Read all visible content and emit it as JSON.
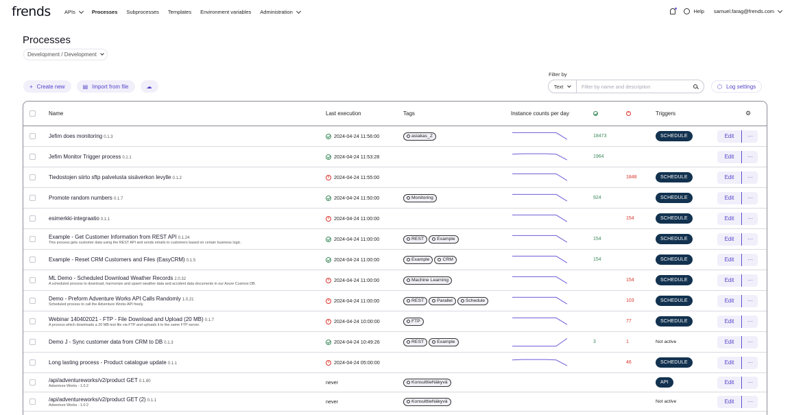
{
  "brand": {
    "logo": "frends"
  },
  "nav": {
    "items": [
      {
        "label": "APIs",
        "dropdown": true,
        "active": false
      },
      {
        "label": "Processes",
        "dropdown": false,
        "active": true
      },
      {
        "label": "Subprocesses",
        "dropdown": false,
        "active": false
      },
      {
        "label": "Templates",
        "dropdown": false,
        "active": false
      },
      {
        "label": "Environment variables",
        "dropdown": false,
        "active": false
      },
      {
        "label": "Administration",
        "dropdown": true,
        "active": false
      }
    ],
    "help": "Help",
    "user": "samuel.farag@frends.com"
  },
  "page": {
    "title": "Processes",
    "environment": "Development / Development"
  },
  "actions": {
    "create_new": "Create new",
    "import": "Import from file",
    "filter_label": "Filter by",
    "filter_type": "Text",
    "filter_placeholder": "Filter by name and description",
    "log_settings": "Log settings"
  },
  "table": {
    "headers": {
      "name": "Name",
      "last_execution": "Last execution",
      "tags": "Tags",
      "instance_counts": "Instance counts per day",
      "triggers": "Triggers"
    },
    "edit_label": "Edit",
    "more_label": "···",
    "rows": [
      {
        "name": "Jefim does monitoring",
        "version": "0.1.3",
        "desc": "",
        "status": "ok",
        "last": "2024-04-24 11:56:00",
        "tags": [
          "asiakas_Z"
        ],
        "ok": "18473",
        "err": "",
        "trigger": "SCHEDULE",
        "spark": [
          0.9,
          0.9,
          0.9,
          0.9,
          0.9,
          0.2
        ]
      },
      {
        "name": "Jefim Monitor Trigger process",
        "version": "0.1.1",
        "desc": "",
        "status": "ok",
        "last": "2024-04-24 11:53:28",
        "tags": [],
        "ok": "1964",
        "err": "",
        "trigger": "",
        "spark": [
          0.8,
          0.85,
          0.85,
          0.85,
          0.8,
          0.2
        ]
      },
      {
        "name": "Tiedostojen siirto sftp palvelusta sisäverkon levylle",
        "version": "0.1.2",
        "desc": "",
        "status": "err",
        "last": "2024-04-24 11:55:00",
        "tags": [],
        "ok": "",
        "err": "1848",
        "trigger": "SCHEDULE",
        "spark": [
          0.9,
          0.9,
          0.9,
          0.9,
          0.9,
          0.2
        ]
      },
      {
        "name": "Promote random numbers",
        "version": "0.1.7",
        "desc": "",
        "status": "ok",
        "last": "2024-04-24 11:50:00",
        "tags": [
          "Monitoring"
        ],
        "ok": "924",
        "err": "",
        "trigger": "SCHEDULE",
        "spark": [
          0.9,
          0.9,
          0.9,
          0.9,
          0.9,
          0.2
        ]
      },
      {
        "name": "esimerkki-integraatio",
        "version": "0.1.1",
        "desc": "",
        "status": "err",
        "last": "2024-04-24 11:00:00",
        "tags": [],
        "ok": "",
        "err": "154",
        "trigger": "SCHEDULE",
        "spark": [
          0.9,
          0.9,
          0.9,
          0.9,
          0.9,
          0.2
        ]
      },
      {
        "name": "Example - Get Customer Information from REST API",
        "version": "0.1.24",
        "desc": "This process gets customer data using the REST API and sends emails to customers based on certain business logic.",
        "status": "ok",
        "last": "2024-04-24 11:00:00",
        "tags": [
          "REST",
          "Example"
        ],
        "ok": "154",
        "err": "",
        "trigger": "SCHEDULE",
        "spark": [
          0.9,
          0.9,
          0.9,
          0.9,
          0.9,
          0.2
        ]
      },
      {
        "name": "Example - Reset CRM Customers and Files (EasyCRM)",
        "version": "0.1.5",
        "desc": "",
        "status": "ok",
        "last": "2024-04-24 11:00:00",
        "tags": [
          "Example",
          "CRM"
        ],
        "ok": "154",
        "err": "",
        "trigger": "SCHEDULE",
        "spark": [
          0.9,
          0.9,
          0.9,
          0.9,
          0.9,
          0.2
        ]
      },
      {
        "name": "ML Demo - Scheduled Download Weather Records",
        "version": "2.0.32",
        "desc": "A scheduled process to download, harmonize and upsert weather data and accident data documents in our Azure Cosmos DB.",
        "status": "err",
        "last": "2024-04-24 11:00:00",
        "tags": [
          "Machine Learning"
        ],
        "ok": "",
        "err": "154",
        "trigger": "SCHEDULE",
        "spark": [
          0.9,
          0.9,
          0.9,
          0.9,
          0.9,
          0.2
        ]
      },
      {
        "name": "Demo - Preform Adventure Works API Calls Randomly",
        "version": "1.0.21",
        "desc": "Scheduled process to call the Adventure Works API freely.",
        "status": "err",
        "last": "2024-04-24 11:00:00",
        "tags": [
          "REST",
          "Parallel",
          "Schedule"
        ],
        "ok": "",
        "err": "103",
        "trigger": "SCHEDULE",
        "spark": [
          0.9,
          0.9,
          0.9,
          0.9,
          0.9,
          0.2
        ]
      },
      {
        "name": "Webinar 140402021 - FTP - File Download and Upload (20 MB)",
        "version": "0.1.7",
        "desc": "A process which downloads a 20 MB test file via FTP and uploads it to the same FTP server.",
        "status": "err",
        "last": "2024-04-24 10:00:00",
        "tags": [
          "FTP"
        ],
        "ok": "",
        "err": "77",
        "trigger": "SCHEDULE",
        "spark": [
          0.9,
          0.9,
          0.9,
          0.9,
          0.9,
          0.2
        ]
      },
      {
        "name": "Demo J - Sync customer data from CRM to DB",
        "version": "0.1.3",
        "desc": "",
        "status": "ok",
        "last": "2024-04-24 10:49:26",
        "tags": [
          "REST",
          "Example"
        ],
        "ok": "3",
        "err": "1",
        "trigger": "Not active",
        "spark": [
          0.1,
          0.1,
          0.1,
          0.1,
          0.1,
          0.9
        ]
      },
      {
        "name": "Long lasting process - Product catalogue update",
        "version": "0.1.1",
        "desc": "",
        "status": "err",
        "last": "2024-04-24 05:00:00",
        "tags": [],
        "ok": "",
        "err": "46",
        "trigger": "SCHEDULE",
        "spark": [
          0.8,
          0.85,
          0.85,
          0.85,
          0.8,
          0.2
        ]
      },
      {
        "name": "/api/adventureworks/v2/product GET",
        "version": "0.1.80",
        "desc": "Adventure Works - 1.0.2",
        "status": "none",
        "last": "never",
        "tags": [
          "KonsulttiеNäkyvä"
        ],
        "ok": "",
        "err": "",
        "trigger": "API",
        "spark": []
      },
      {
        "name": "/api/adventureworks/v2/product GET (2)",
        "version": "0.1.1",
        "desc": "Adventure Works - 1.0.2",
        "status": "none",
        "last": "never",
        "tags": [
          "KonsulttiеNäkyvä"
        ],
        "ok": "",
        "err": "",
        "trigger": "Not active",
        "spark": []
      }
    ]
  },
  "colors": {
    "accent": "#5244c9",
    "ok": "#3a8a5a",
    "error": "#d9342b",
    "badge": "#12324f"
  }
}
